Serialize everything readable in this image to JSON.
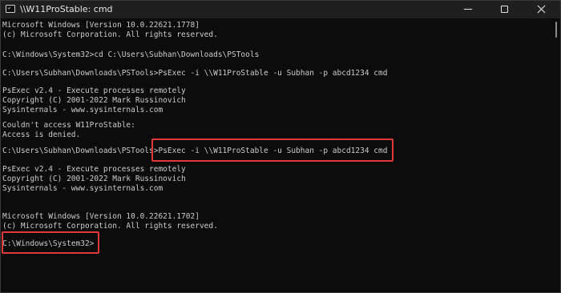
{
  "window": {
    "title": "\\\\W11ProStable: cmd"
  },
  "console": {
    "lines": [
      "Microsoft Windows [Version 10.0.22621.1778]",
      "(c) Microsoft Corporation. All rights reserved.",
      "",
      "C:\\Windows\\System32>cd C:\\Users\\Subhan\\Downloads\\PSTools",
      "",
      "C:\\Users\\Subhan\\Downloads\\PSTools>PsExec -i \\\\W11ProStable -u Subhan -p abcd1234 cmd",
      "",
      "PsExec v2.4 - Execute processes remotely",
      "Copyright (C) 2001-2022 Mark Russinovich",
      "Sysinternals - www.sysinternals.com",
      "",
      "Couldn't access W11ProStable:",
      "Access is denied.",
      "",
      "C:\\Users\\Subhan\\Downloads\\PSTools>PsExec -i \\\\W11ProStable -u Subhan -p abcd1234 cmd",
      "",
      "PsExec v2.4 - Execute processes remotely",
      "Copyright (C) 2001-2022 Mark Russinovich",
      "Sysinternals - www.sysinternals.com",
      "",
      "",
      "Microsoft Windows [Version 10.0.22621.1702]",
      "(c) Microsoft Corporation. All rights reserved.",
      "",
      "C:\\Windows\\System32>"
    ]
  },
  "colors": {
    "background": "#0c0c0c",
    "titlebar": "#1f1f1f",
    "text": "#cccccc",
    "highlight_border": "#e0383b"
  },
  "icons": {
    "app": "terminal-icon",
    "minimize": "minimize-icon",
    "maximize": "maximize-icon",
    "close": "close-icon"
  }
}
